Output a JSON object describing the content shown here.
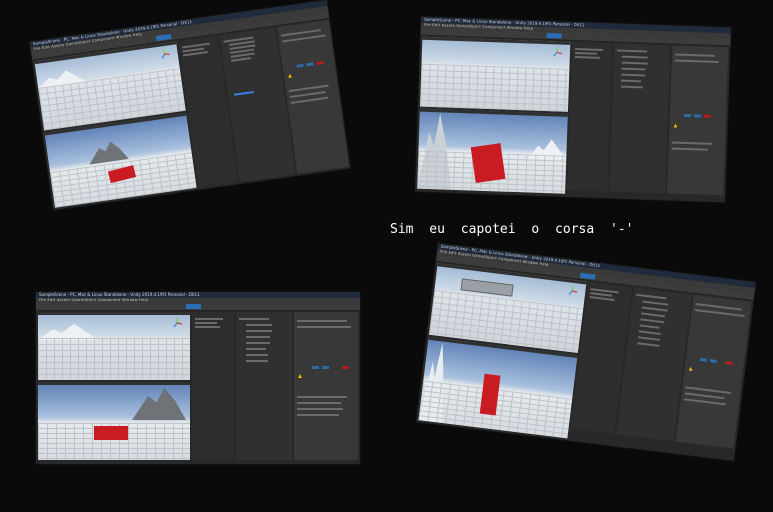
{
  "caption": "Sim eu capotei o corsa '-'",
  "window_title": "SampleScene - PC, Mac & Linux Standalone - Unity 2019.4.19f1 Personal - DX11",
  "menu": "File  Edit  Assets  GameObject  Component  Window  Help",
  "colors": {
    "background": "#0a0a0a",
    "editor": "#282828",
    "car": "#c91b22",
    "play_button": "#2a6fb5"
  }
}
